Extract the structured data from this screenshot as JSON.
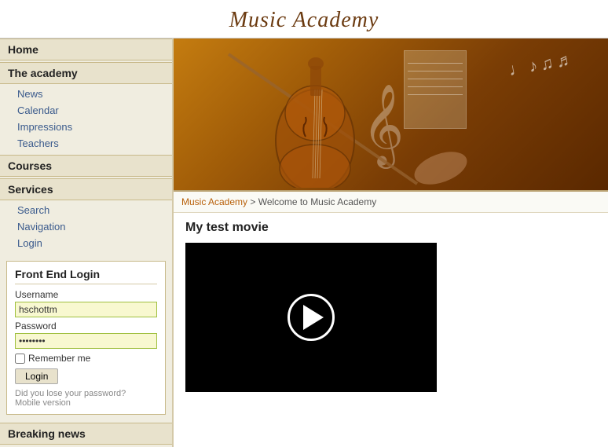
{
  "header": {
    "title": "Music Academy"
  },
  "sidebar": {
    "sections": [
      {
        "label": "Home",
        "items": []
      },
      {
        "label": "The academy",
        "items": [
          "News",
          "Calendar",
          "Impressions",
          "Teachers"
        ]
      },
      {
        "label": "Courses",
        "items": []
      },
      {
        "label": "Services",
        "items": [
          "Search",
          "Navigation",
          "Login"
        ]
      }
    ],
    "login_panel": {
      "title": "Front End Login",
      "username_label": "Username",
      "username_value": "hschottm",
      "password_label": "Password",
      "password_value": "••••••••",
      "remember_label": "Remember me",
      "login_button": "Login",
      "forgot_password": "Did you lose your password?",
      "mobile_link": "Mobile version"
    },
    "breaking_label": "Breaking news"
  },
  "main": {
    "breadcrumb_link": "Music Academy",
    "breadcrumb_separator": " > ",
    "breadcrumb_current": "Welcome to Music Academy",
    "video_title": "My test movie",
    "hero_notes": "♩♪♫♬"
  }
}
